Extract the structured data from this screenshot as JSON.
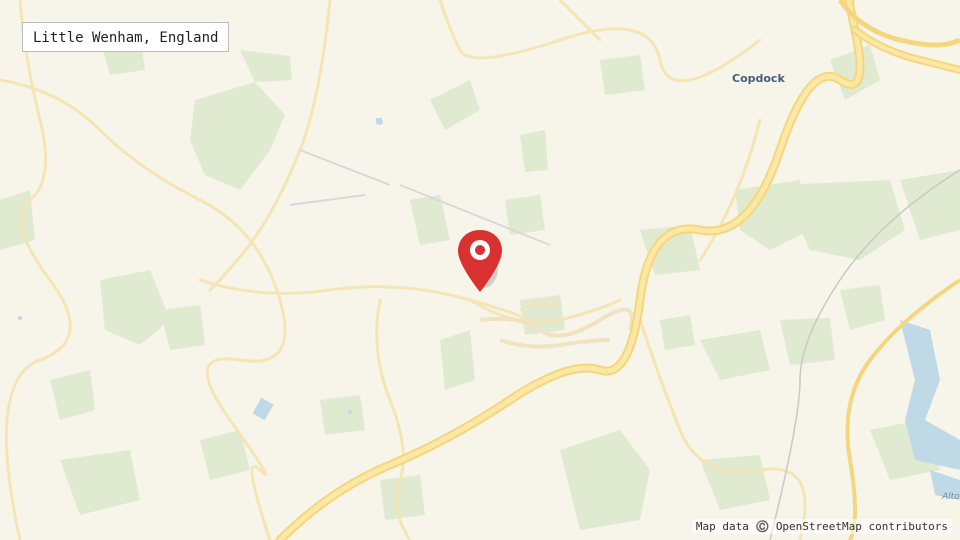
{
  "location": {
    "label": "Little Wenham, England"
  },
  "map": {
    "attribution": "Map data ©️ OpenStreetMap contributors",
    "town_labels": {
      "copdock": "Copdock"
    },
    "water_label": "Alto",
    "marker_icon": "map-pin-icon",
    "colors": {
      "land": "#f7f4ea",
      "woodland": "#dfead0",
      "road_major": "#f8dc8e",
      "road_minor": "#f3e6b4",
      "water": "#bfd9e6",
      "marker": "#d93030"
    }
  }
}
